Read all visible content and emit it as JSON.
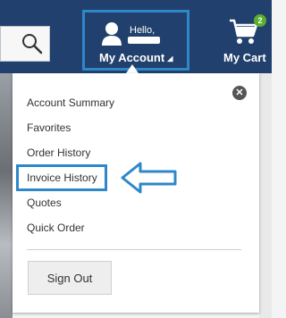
{
  "header": {
    "greeting": "Hello,",
    "account_label": "My Account",
    "account_caret": "◢",
    "cart_label": "My Cart",
    "cart_count": "2"
  },
  "icons": {
    "search": "search-icon",
    "user": "user-icon",
    "cart": "shopping-cart-icon",
    "close": "close-icon",
    "callout_arrow": "left-arrow-callout"
  },
  "menu": {
    "items": [
      {
        "label": "Account Summary"
      },
      {
        "label": "Favorites"
      },
      {
        "label": "Order History"
      },
      {
        "label": "Invoice History"
      },
      {
        "label": "Quotes"
      },
      {
        "label": "Quick Order"
      }
    ],
    "close_symbol": "✕",
    "sign_out_label": "Sign Out"
  },
  "colors": {
    "header_bg": "#21406d",
    "highlight": "#2e87c9",
    "badge": "#5cae2e"
  }
}
